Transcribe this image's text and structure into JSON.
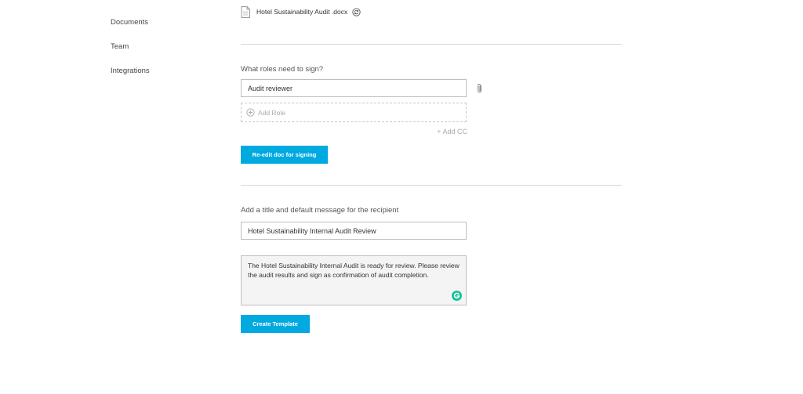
{
  "sidebar": {
    "items": [
      {
        "label": "Documents"
      },
      {
        "label": "Team"
      },
      {
        "label": "Integrations"
      }
    ]
  },
  "document": {
    "filename": "Hotel Sustainability Audit .docx",
    "file_icon": "document-icon",
    "replace_icon": "replace-icon"
  },
  "roles": {
    "heading": "What roles need to sign?",
    "role_1_value": "Audit reviewer",
    "attach_icon": "paperclip-icon",
    "add_role_label": "Add Role",
    "add_cc_label": "+ Add CC",
    "reedit_button_label": "Re-edit doc for signing"
  },
  "message": {
    "heading": "Add a title and default message for the recipient",
    "title_value": "Hotel Sustainability Internal Audit Review",
    "body_value": "The Hotel Sustainability Internal Audit is ready for review. Please review the audit results and sign as confirmation of audit completion.",
    "grammarly_icon": "grammarly-icon"
  },
  "actions": {
    "create_template_label": "Create Template"
  },
  "colors": {
    "accent": "#00a9e0",
    "divider": "#d9d9d9",
    "grammarly": "#15c39a"
  }
}
